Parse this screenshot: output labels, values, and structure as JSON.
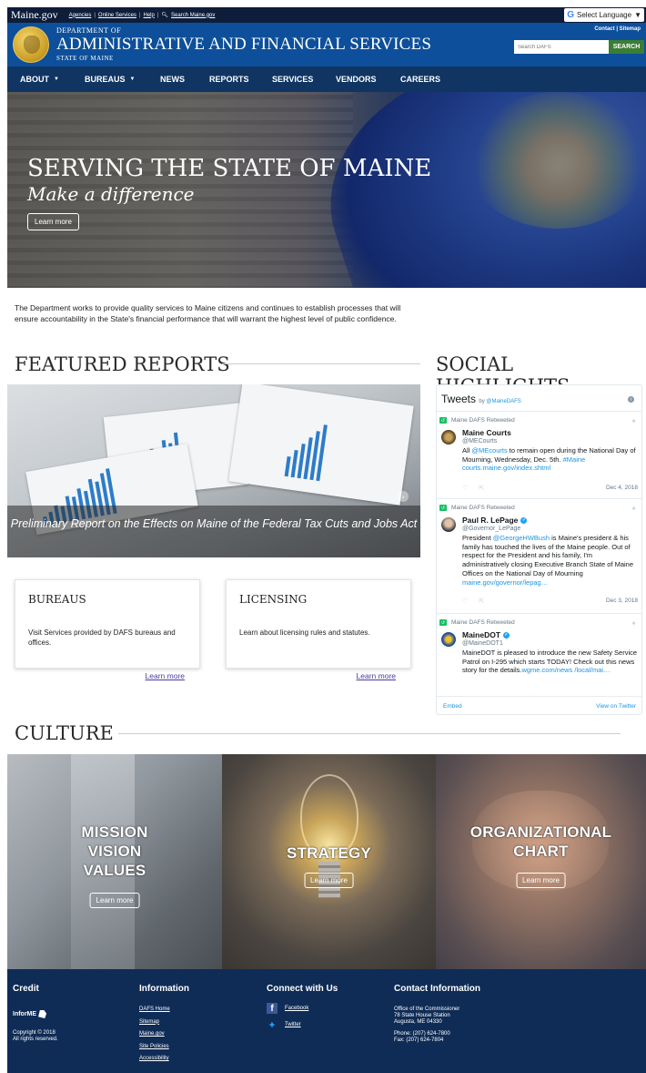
{
  "top_bar": {
    "brand": "Maine.gov",
    "links": [
      "Agencies",
      "Online Services",
      "Help"
    ],
    "search_link": "Search Maine.gov",
    "language": "Select Language"
  },
  "header": {
    "dept_small": "DEPARTMENT OF",
    "dept_large": "ADMINISTRATIVE AND FINANCIAL SERVICES",
    "state": "STATE OF MAINE",
    "links": "Contact | Sitemap",
    "search_placeholder": "Search DAFS",
    "search_button": "SEARCH"
  },
  "nav": {
    "items": [
      "ABOUT",
      "BUREAUS",
      "NEWS",
      "REPORTS",
      "SERVICES",
      "VENDORS",
      "CAREERS"
    ]
  },
  "hero": {
    "title": "SERVING THE STATE OF MAINE",
    "subtitle": "Make a difference",
    "button": "Learn more"
  },
  "intro": "The Department works to provide quality services to Maine citizens and continues to establish processes that will ensure accountability in the State's financial performance that will warrant the highest level of public confidence.",
  "featured": {
    "title": "FEATURED REPORTS",
    "caption": "Preliminary Report on the Effects on Maine of the Federal Tax Cuts and Jobs Act"
  },
  "cards": [
    {
      "title": "BUREAUS",
      "body": "Visit Services provided by DAFS bureaus and offices.",
      "link": "Learn more"
    },
    {
      "title": "LICENSING",
      "body": "Learn about licensing rules and statutes.",
      "link": "Learn more"
    }
  ],
  "social": {
    "title": "SOCIAL HIGHLIGHTS",
    "widget_title": "Tweets",
    "widget_by": "by",
    "widget_handle": "@MaineDAFS",
    "tweets": [
      {
        "retweeted": "Maine DAFS Retweeted",
        "name": "Maine Courts",
        "handle": "@MECourts",
        "text_1": "All ",
        "mention": "@MEcourts",
        "text_2": " to remain open during the National Day of Mourning, Wednesday, Dec. 5th. ",
        "link": "#Maine courts.maine.gov/index.shtml",
        "date": "Dec 4, 2018"
      },
      {
        "retweeted": "Maine DAFS Retweeted",
        "name": "Paul R. LePage",
        "handle": "@Governor_LePage",
        "text_1": "President ",
        "mention": "@GeorgeHWBush",
        "text_2": " is Maine's president & his family has touched the lives of the Maine people. Out of respect for the President and his family, I'm administratively closing Executive Branch State of Maine Offices on the National Day of Mourning ",
        "link": "maine.gov/governor/lepag…",
        "date": "Dec 3, 2018"
      },
      {
        "retweeted": "Maine DAFS Retweeted",
        "name": "MaineDOT",
        "handle": "@MaineDOT1",
        "text_1": "MaineDOT is pleased to introduce the new Safety Service Patrol on I-295 which starts TODAY! Check out this news story for the details.",
        "mention": "",
        "text_2": "",
        "link": "wgme.com/news /local/mai…",
        "date": ""
      }
    ],
    "embed": "Embed",
    "view": "View on Twitter"
  },
  "culture": {
    "title": "CULTURE",
    "tiles": [
      {
        "label_lines": [
          "MISSION",
          "VISION",
          "VALUES"
        ],
        "button": "Learn more"
      },
      {
        "label_lines": [
          "STRATEGY"
        ],
        "button": "Learn more"
      },
      {
        "label_lines": [
          "ORGANIZATIONAL",
          "CHART"
        ],
        "button": "Learn more"
      }
    ]
  },
  "footer": {
    "credit": {
      "title": "Credit",
      "logo": "InforME",
      "copyright": "Copyright © 2018",
      "rights": "All rights reserved."
    },
    "information": {
      "title": "Information",
      "links": [
        "DAFS Home",
        "Sitemap",
        "Maine.gov",
        "Site Policies",
        "Accessibility"
      ]
    },
    "connect": {
      "title": "Connect with Us",
      "links": [
        "Facebook",
        "Twitter"
      ]
    },
    "contact": {
      "title": "Contact Information",
      "office": "Office of the Commissioner",
      "street": "78 State House Station",
      "city": "Augusta, ME 04330",
      "phone": "Phone: (207) 624-7800",
      "fax": "Fax: (207) 624-7804"
    }
  },
  "colors": {
    "header_blue": "#0d4f9a",
    "nav_navy": "#103563",
    "footer_navy": "#0f2c56",
    "search_green": "#3a7e35",
    "twitter_blue": "#1b95e0",
    "link_purple": "#4d3b9e"
  }
}
